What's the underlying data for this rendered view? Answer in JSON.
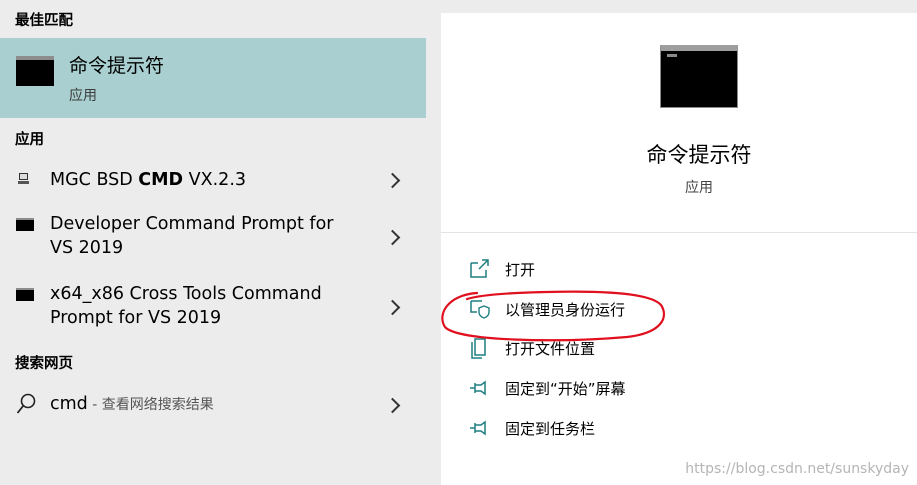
{
  "sections": {
    "best_match": "最佳匹配",
    "apps": "应用",
    "web_search": "搜索网页"
  },
  "best_match": {
    "title": "命令提示符",
    "subtitle": "应用"
  },
  "apps": [
    {
      "lines": [
        "MGC BSD CMD VX.2.3"
      ],
      "name_pre": "MGC BSD ",
      "name_bold": "CMD",
      "name_post": " VX.2.3"
    },
    {
      "lines": [
        "Developer Command Prompt for",
        "VS 2019"
      ]
    },
    {
      "lines": [
        "x64_x86 Cross Tools Command",
        "Prompt for VS 2019"
      ]
    }
  ],
  "web_search": {
    "query": "cmd",
    "separator": " - ",
    "hint": "查看网络搜索结果"
  },
  "detail": {
    "title": "命令提示符",
    "subtitle": "应用",
    "actions": [
      {
        "label": "打开",
        "icon": "open-icon"
      },
      {
        "label": "以管理员身份运行",
        "icon": "shield-icon"
      },
      {
        "label": "打开文件位置",
        "icon": "file-location-icon"
      },
      {
        "label": "固定到“开始”屏幕",
        "icon": "pin-icon"
      },
      {
        "label": "固定到任务栏",
        "icon": "pin-icon"
      }
    ]
  },
  "watermark": "https://blog.csdn.net/sunskyday",
  "colors": {
    "selected_bg": "#a9cfd0",
    "left_bg": "#ececec",
    "right_bg": "#ffffff",
    "icon_accent": "#1e7f80",
    "annotation": "#e0101e"
  }
}
